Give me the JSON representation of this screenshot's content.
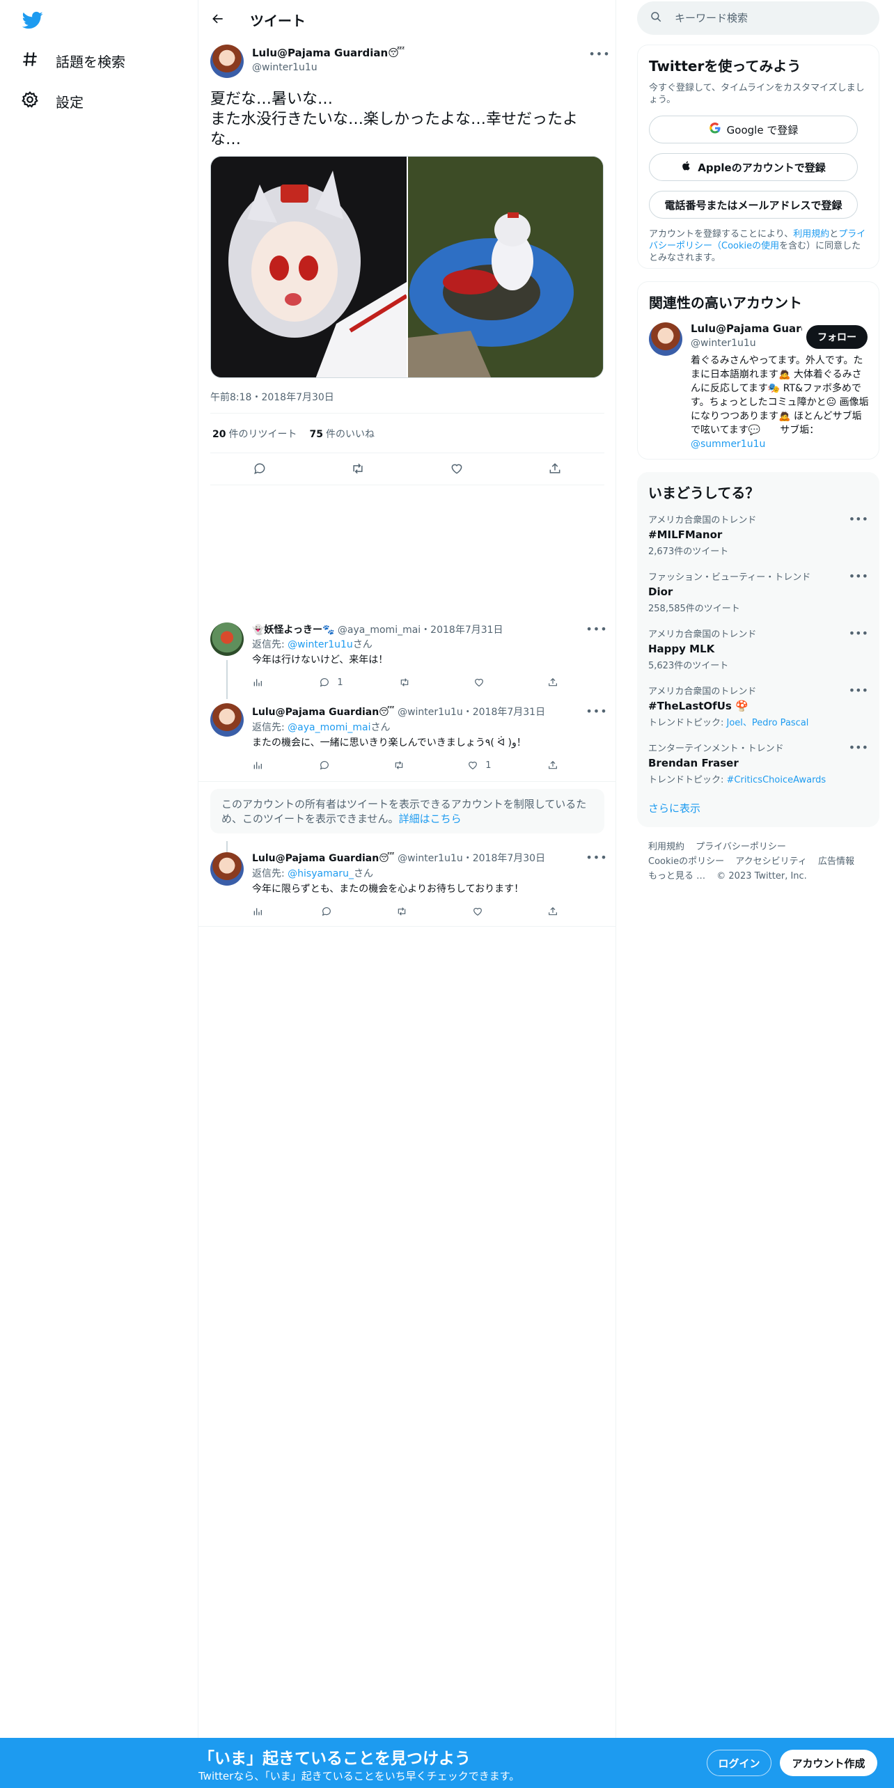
{
  "nav": {
    "logo": "twitter-bird-icon",
    "items": [
      {
        "icon": "hashtag-icon",
        "label": "話題を検索"
      },
      {
        "icon": "gear-icon",
        "label": "設定"
      }
    ]
  },
  "header": {
    "back_icon": "arrow-left-icon",
    "title": "ツイート"
  },
  "tweet": {
    "name": "Lulu@Pajama Guardian😴",
    "handle": "@winter1u1u",
    "text": "夏だな…暑いな…\nまた水没行きたいな…楽しかったよな…幸せだったよな…",
    "media": [
      "costume-photo-closeup",
      "costume-photo-float-ring"
    ],
    "time": "午前8:18・2018年7月30日",
    "retweets_count": "20",
    "retweets_label": "件のリツイート",
    "likes_count": "75",
    "likes_label": "件のいいね"
  },
  "replies": [
    {
      "name": "👻妖怪よっきー🐾",
      "handle": "@aya_momi_mai",
      "date": "・2018年7月31日",
      "reply_label": "返信先: ",
      "reply_to": "@winter1u1u",
      "reply_suffix": "さん",
      "text": "今年は行けないけど、来年は！",
      "reply_count": "1",
      "retweet_count": "",
      "like_count": ""
    },
    {
      "name": "Lulu@Pajama Guardian😴",
      "handle": "@winter1u1u",
      "date": "・2018年7月31日",
      "reply_label": "返信先: ",
      "reply_to": "@aya_momi_mai",
      "reply_suffix": "さん",
      "text": "またの機会に、一緒に思いきり楽しんでいきましょう٩( ᐛ )و！",
      "reply_count": "",
      "retweet_count": "",
      "like_count": "1"
    },
    {
      "name": "Lulu@Pajama Guardian😴",
      "handle": "@winter1u1u",
      "date": "・2018年7月30日",
      "reply_label": "返信先: ",
      "reply_to": "@hisyamaru_",
      "reply_suffix": "さん",
      "text": "今年に限らずとも、またの機会を心よりお待ちしております！",
      "reply_count": "",
      "retweet_count": "",
      "like_count": ""
    }
  ],
  "notice": {
    "text": "このアカウントの所有者はツイートを表示できるアカウントを制限しているため、このツイートを表示できません。",
    "link": "詳細はこちら"
  },
  "search": {
    "placeholder": "キーワード検索"
  },
  "signup": {
    "title": "Twitterを使ってみよう",
    "subtitle": "今すぐ登録して、タイムラインをカスタマイズしましょう。",
    "google": "Google で登録",
    "apple": "Appleのアカウントで登録",
    "phone": "電話番号またはメールアドレスで登録",
    "legal_prefix": "アカウントを登録することにより、",
    "terms": "利用規約",
    "and": "と",
    "privacy": "プライバシーポリシー",
    "cookie": "（Cookieの使用",
    "legal_suffix": "を含む）に同意したとみなされます。"
  },
  "related": {
    "title": "関連性の高いアカウント",
    "name": "Lulu@Pajama Guardi...",
    "handle": "@winter1u1u",
    "follow": "フォロー",
    "bio": "着ぐるみさんやってます。外人です。たまに日本語崩れます🙇 大体着ぐるみさんに反応してます🎭 RT&ファボ多めです。ちょっとしたコミュ障かと😐 画像垢になりつつあります🙇 ほとんどサブ垢で呟いてます💬　　サブ垢：",
    "bio_link": "@summer1u1u"
  },
  "trends": {
    "title": "いまどうしてる？",
    "items": [
      {
        "category": "アメリカ合衆国のトレンド",
        "name": "#MILFManor",
        "meta": "2,673件のツイート"
      },
      {
        "category": "ファッション・ビューティー・トレンド",
        "name": "Dior",
        "meta": "258,585件のツイート"
      },
      {
        "category": "アメリカ合衆国のトレンド",
        "name": "Happy MLK",
        "meta": "5,623件のツイート"
      },
      {
        "category": "アメリカ合衆国のトレンド",
        "name": "#TheLastOfUs 🍄",
        "meta_prefix": "トレンドトピック: ",
        "meta_links": "Joel、Pedro Pascal"
      },
      {
        "category": "エンターテインメント・トレンド",
        "name": "Brendan Fraser",
        "meta_prefix": "トレンドトピック: ",
        "meta_links": "#CriticsChoiceAwards"
      }
    ],
    "show_more": "さらに表示"
  },
  "footer": {
    "links": [
      "利用規約",
      "プライバシーポリシー",
      "Cookieのポリシー",
      "アクセシビリティ",
      "広告情報",
      "もっと見る …"
    ],
    "copyright": "© 2023 Twitter, Inc."
  },
  "banner": {
    "title": "「いま」起きていることを見つけよう",
    "subtitle": "Twitterなら、「いま」起きていることをいち早くチェックできます。",
    "login": "ログイン",
    "signup": "アカウント作成"
  },
  "colors": {
    "accent": "#1d9bf0",
    "text": "#0f1419",
    "muted": "#536471",
    "border": "#eff3f4"
  }
}
